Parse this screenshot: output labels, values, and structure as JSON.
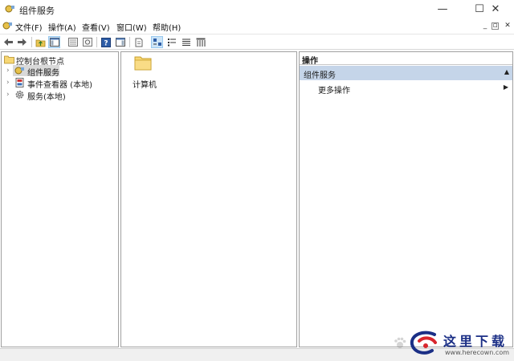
{
  "window": {
    "title": "组件服务",
    "controls": {
      "minimize": "—",
      "maximize": "☐",
      "close": "✕"
    }
  },
  "menu": {
    "items": [
      "文件(F)",
      "操作(A)",
      "查看(V)",
      "窗口(W)",
      "帮助(H)"
    ],
    "mdi_controls": [
      "_",
      "▫",
      "✕"
    ]
  },
  "toolbar": {
    "buttons": [
      "back-arrow-icon",
      "forward-arrow-icon",
      "up-folder-icon",
      "show-tree-icon",
      "properties-icon",
      "refresh-icon",
      "help-icon",
      "show-action-pane-icon",
      "export-list-icon",
      "large-icons-view-icon",
      "small-icons-view-icon",
      "list-view-icon",
      "details-view-icon"
    ],
    "pressed": "large-icons-view-icon"
  },
  "tree": {
    "root": "控制台根节点",
    "items": [
      {
        "label": "组件服务",
        "icon": "component-services-icon",
        "selected": true
      },
      {
        "label": "事件查看器 (本地)",
        "icon": "event-viewer-icon",
        "selected": false
      },
      {
        "label": "服务(本地)",
        "icon": "services-gear-icon",
        "selected": false
      }
    ]
  },
  "list": {
    "items": [
      {
        "label": "计算机",
        "icon": "folder-icon"
      }
    ]
  },
  "actions": {
    "header": "操作",
    "section": "组件服务",
    "rows": [
      {
        "label": "更多操作"
      }
    ]
  },
  "watermark": {
    "title": "这里下载",
    "url": "www.herecown.com"
  },
  "colors": {
    "section_bg": "#c5d5e9",
    "selection_bg": "#d9d9d9",
    "folder": "#f7d774",
    "watermark_blue": "#1b2f86",
    "watermark_red": "#d8262d"
  }
}
